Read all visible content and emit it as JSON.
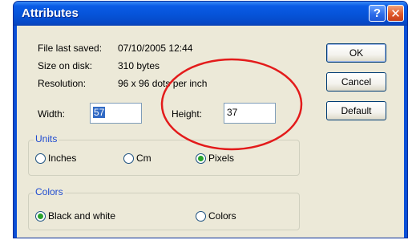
{
  "window": {
    "title": "Attributes",
    "help_label": "?",
    "close_label": "✕"
  },
  "info": {
    "last_saved_label": "File last saved:",
    "last_saved_value": "07/10/2005 12:44",
    "size_label": "Size on disk:",
    "size_value": "310 bytes",
    "resolution_label": "Resolution:",
    "resolution_value": "96 x 96 dots per inch"
  },
  "dimensions": {
    "width_label": "Width:",
    "width_value": "57",
    "height_label": "Height:",
    "height_value": "37"
  },
  "units": {
    "legend": "Units",
    "options": [
      "Inches",
      "Cm",
      "Pixels"
    ],
    "selected": "Pixels"
  },
  "colors": {
    "legend": "Colors",
    "options": [
      "Black and white",
      "Colors"
    ],
    "selected": "Black and white"
  },
  "buttons": {
    "ok": "OK",
    "cancel": "Cancel",
    "default": "Default"
  },
  "annotation": {
    "color": "#e31b1b",
    "shape": "ellipse"
  }
}
